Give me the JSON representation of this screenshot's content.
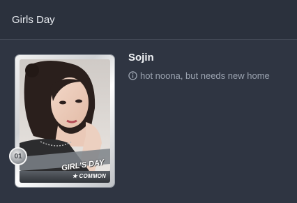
{
  "header": {
    "title": "Girls Day"
  },
  "card": {
    "name": "Sojin",
    "description": "hot noona, but needs new home",
    "number": "01",
    "group_banner": "GIRL'S DAY",
    "rarity": "★ COMMON",
    "photo_icon": "portrait-photo"
  },
  "colors": {
    "background": "#2f3542",
    "header": "#2b313d",
    "divider": "#434a57",
    "muted_text": "#9ba3b0"
  }
}
